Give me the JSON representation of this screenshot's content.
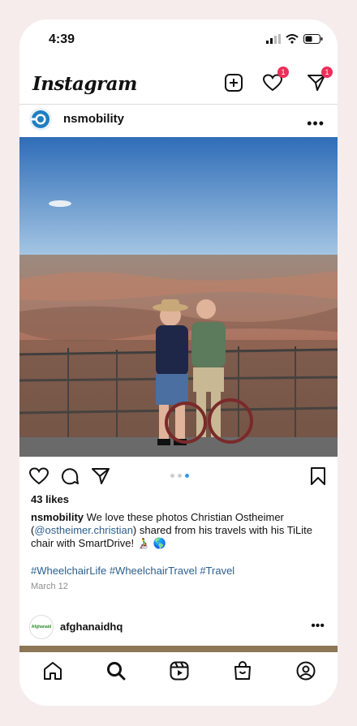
{
  "status_bar": {
    "time": "4:39"
  },
  "topbar": {
    "logo": "Instagram",
    "icons": [
      "new-post-icon",
      "heart-icon",
      "direct-message-icon"
    ],
    "activity_badge": "1",
    "messages_badge": "1"
  },
  "post": {
    "username": "nsmobility",
    "image_alt": "Two men posing at the Grand Canyon overlook, one seated in a wheelchair",
    "likes": "43 likes",
    "caption_user": "nsmobility",
    "caption_text_1": " We love these photos Christian Ostheimer (",
    "caption_mention": "@ostheimer.christian",
    "caption_text_2": ") shared from his travels with his TiLite chair with SmartDrive! 👨‍🦽 🌎",
    "hashtags": "#WheelchairLife #WheelchairTravel #Travel",
    "date": "March 12",
    "carousel": {
      "count": 3,
      "active": 3
    }
  },
  "next_post": {
    "username": "afghanaidhq",
    "avatar_text": "Afghanaid"
  },
  "bottom_nav": [
    "home-icon",
    "search-icon",
    "reels-icon",
    "shop-icon",
    "profile-icon"
  ],
  "colors": {
    "badge": "#ed2e5a",
    "link": "#2d5e8c",
    "carousel_active": "#3897f0"
  }
}
